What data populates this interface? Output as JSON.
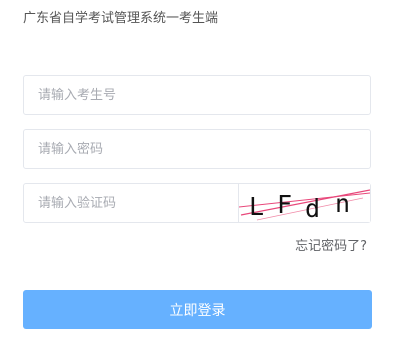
{
  "header": {
    "title": "广东省自学考试管理系统一考生端"
  },
  "form": {
    "candidate_number": {
      "value": "",
      "placeholder": "请输入考生号"
    },
    "password": {
      "value": "",
      "placeholder": "请输入密码"
    },
    "verification_code": {
      "value": "",
      "placeholder": "请输入验证码"
    },
    "captcha": {
      "chars": [
        "L",
        "F",
        "d",
        "n"
      ]
    },
    "forgot_password_label": "忘记密码了?",
    "login_label": "立即登录"
  },
  "colors": {
    "primary_button": "#66b1ff",
    "border": "#e4e7ed",
    "placeholder": "#a8abb2",
    "captcha_noise": "#e8477a"
  }
}
